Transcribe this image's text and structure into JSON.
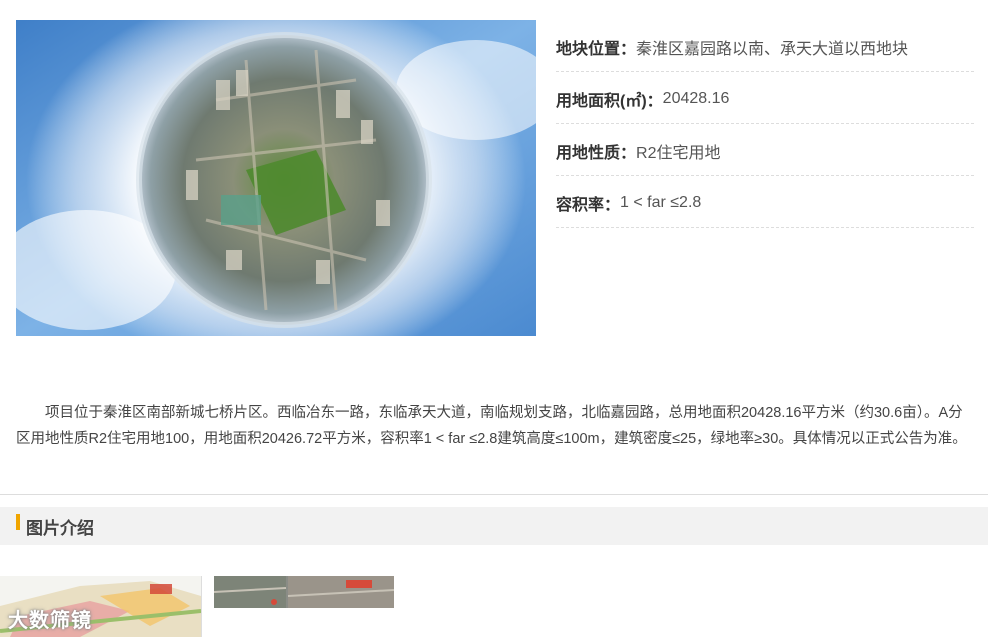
{
  "info": [
    {
      "label": "地块位置：",
      "value": "秦淮区嘉园路以南、承天大道以西地块"
    },
    {
      "label": "用地面积(㎡)：",
      "value": "20428.16"
    },
    {
      "label": "用地性质：",
      "value": "R2住宅用地"
    },
    {
      "label": "容积率：",
      "value": "1 < far ≤2.8"
    }
  ],
  "description": "项目位于秦淮区南部新城七桥片区。西临冶东一路，东临承天大道，南临规划支路，北临嘉园路，总用地面积20428.16平方米（约30.6亩）。A分区用地性质R2住宅用地100，用地面积20426.72平方米，容积率1 < far ≤2.8建筑高度≤100m，建筑密度≤25，绿地率≥30。具体情况以正式公告为准。",
  "section": {
    "title": "图片介绍"
  },
  "watermark": "大数筛镜",
  "colors": {
    "accent": "#f0a500",
    "section_bg": "#f2f2f2"
  }
}
